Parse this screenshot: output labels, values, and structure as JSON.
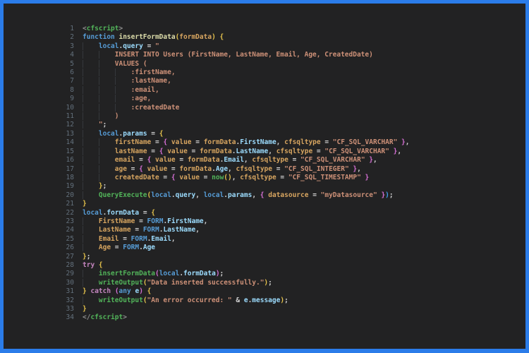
{
  "meta": {
    "frame_border_color": "#2b7ce9",
    "editor_background": "#222223",
    "line_number_color": "#63707c",
    "indent_guide_color": "#35383c"
  },
  "colors": {
    "g": "#52b45a",
    "b": "#569cd6",
    "lb": "#9cdcfe",
    "id": "#d7a560",
    "fn": "#dcdcaa",
    "s": "#ce9178",
    "k": "#c586c0",
    "p": "#d4d4d4",
    "ab": "#8d8d8d",
    "y": "#e6c34c",
    "m": "#d670d6",
    "bb": "#3d9fef"
  },
  "code": {
    "language": "cfscript",
    "lines": [
      {
        "n": 1,
        "i": 0,
        "t": [
          [
            "ab",
            "<"
          ],
          [
            "g",
            "cfscript"
          ],
          [
            "ab",
            ">"
          ]
        ]
      },
      {
        "n": 2,
        "i": 0,
        "t": [
          [
            "b",
            "function "
          ],
          [
            "fn",
            "insertFormData"
          ],
          [
            "y",
            "("
          ],
          [
            "id",
            "formData"
          ],
          [
            "y",
            ")"
          ],
          [
            "p",
            " "
          ],
          [
            "y",
            "{"
          ]
        ]
      },
      {
        "n": 3,
        "i": 1,
        "t": [
          [
            "b",
            "local"
          ],
          [
            "p",
            "."
          ],
          [
            "lb",
            "query"
          ],
          [
            "p",
            " = "
          ],
          [
            "s",
            "\""
          ]
        ]
      },
      {
        "n": 4,
        "i": 2,
        "t": [
          [
            "s",
            "INSERT INTO Users (FirstName, LastName, Email, Age, CreatedDate)"
          ]
        ]
      },
      {
        "n": 5,
        "i": 2,
        "t": [
          [
            "s",
            "VALUES ("
          ]
        ]
      },
      {
        "n": 6,
        "i": 3,
        "t": [
          [
            "s",
            ":firstName,"
          ]
        ]
      },
      {
        "n": 7,
        "i": 3,
        "t": [
          [
            "s",
            ":lastName,"
          ]
        ]
      },
      {
        "n": 8,
        "i": 3,
        "t": [
          [
            "s",
            ":email,"
          ]
        ]
      },
      {
        "n": 9,
        "i": 3,
        "t": [
          [
            "s",
            ":age,"
          ]
        ]
      },
      {
        "n": 10,
        "i": 3,
        "t": [
          [
            "s",
            ":createdDate"
          ]
        ]
      },
      {
        "n": 11,
        "i": 2,
        "t": [
          [
            "s",
            ")"
          ]
        ]
      },
      {
        "n": 12,
        "i": 1,
        "t": [
          [
            "s",
            "\""
          ],
          [
            "p",
            ";"
          ]
        ]
      },
      {
        "n": 13,
        "i": 1,
        "t": [
          [
            "b",
            "local"
          ],
          [
            "p",
            "."
          ],
          [
            "lb",
            "params"
          ],
          [
            "p",
            " = "
          ],
          [
            "y",
            "{"
          ]
        ]
      },
      {
        "n": 14,
        "i": 2,
        "t": [
          [
            "id",
            "firstName"
          ],
          [
            "p",
            " = "
          ],
          [
            "m",
            "{"
          ],
          [
            "p",
            " "
          ],
          [
            "id",
            "value"
          ],
          [
            "p",
            " = "
          ],
          [
            "id",
            "formData"
          ],
          [
            "p",
            "."
          ],
          [
            "lb",
            "FirstName"
          ],
          [
            "p",
            ", "
          ],
          [
            "id",
            "cfsqltype"
          ],
          [
            "p",
            " = "
          ],
          [
            "s",
            "\"CF_SQL_VARCHAR\""
          ],
          [
            "m",
            " }"
          ],
          [
            "p",
            ","
          ]
        ]
      },
      {
        "n": 15,
        "i": 2,
        "t": [
          [
            "id",
            "lastName"
          ],
          [
            "p",
            " = "
          ],
          [
            "m",
            "{"
          ],
          [
            "p",
            " "
          ],
          [
            "id",
            "value"
          ],
          [
            "p",
            " = "
          ],
          [
            "id",
            "formData"
          ],
          [
            "p",
            "."
          ],
          [
            "lb",
            "LastName"
          ],
          [
            "p",
            ", "
          ],
          [
            "id",
            "cfsqltype"
          ],
          [
            "p",
            " = "
          ],
          [
            "s",
            "\"CF_SQL_VARCHAR\""
          ],
          [
            "m",
            " }"
          ],
          [
            "p",
            ","
          ]
        ]
      },
      {
        "n": 16,
        "i": 2,
        "t": [
          [
            "id",
            "email"
          ],
          [
            "p",
            " = "
          ],
          [
            "m",
            "{"
          ],
          [
            "p",
            " "
          ],
          [
            "id",
            "value"
          ],
          [
            "p",
            " = "
          ],
          [
            "id",
            "formData"
          ],
          [
            "p",
            "."
          ],
          [
            "lb",
            "Email"
          ],
          [
            "p",
            ", "
          ],
          [
            "id",
            "cfsqltype"
          ],
          [
            "p",
            " = "
          ],
          [
            "s",
            "\"CF_SQL_VARCHAR\""
          ],
          [
            "m",
            " }"
          ],
          [
            "p",
            ","
          ]
        ]
      },
      {
        "n": 17,
        "i": 2,
        "t": [
          [
            "id",
            "age"
          ],
          [
            "p",
            " = "
          ],
          [
            "m",
            "{"
          ],
          [
            "p",
            " "
          ],
          [
            "id",
            "value"
          ],
          [
            "p",
            " = "
          ],
          [
            "id",
            "formData"
          ],
          [
            "p",
            "."
          ],
          [
            "lb",
            "Age"
          ],
          [
            "p",
            ", "
          ],
          [
            "id",
            "cfsqltype"
          ],
          [
            "p",
            " = "
          ],
          [
            "s",
            "\"CF_SQL_INTEGER\""
          ],
          [
            "m",
            " }"
          ],
          [
            "p",
            ","
          ]
        ]
      },
      {
        "n": 18,
        "i": 2,
        "t": [
          [
            "id",
            "createdDate"
          ],
          [
            "p",
            " = "
          ],
          [
            "m",
            "{"
          ],
          [
            "p",
            " "
          ],
          [
            "id",
            "value"
          ],
          [
            "p",
            " = "
          ],
          [
            "g",
            "now"
          ],
          [
            "y",
            "()"
          ],
          [
            "p",
            ", "
          ],
          [
            "id",
            "cfsqltype"
          ],
          [
            "p",
            " = "
          ],
          [
            "s",
            "\"CF_SQL_TIMESTAMP\""
          ],
          [
            "m",
            " }"
          ]
        ]
      },
      {
        "n": 19,
        "i": 1,
        "t": [
          [
            "y",
            "}"
          ],
          [
            "p",
            ";"
          ]
        ]
      },
      {
        "n": 20,
        "i": 1,
        "t": [
          [
            "g",
            "QueryExecute"
          ],
          [
            "y",
            "("
          ],
          [
            "b",
            "local"
          ],
          [
            "p",
            "."
          ],
          [
            "lb",
            "query"
          ],
          [
            "p",
            ", "
          ],
          [
            "b",
            "local"
          ],
          [
            "p",
            "."
          ],
          [
            "lb",
            "params"
          ],
          [
            "p",
            ", "
          ],
          [
            "m",
            "{"
          ],
          [
            "p",
            " "
          ],
          [
            "id",
            "datasource"
          ],
          [
            "p",
            " = "
          ],
          [
            "s",
            "\"myDatasource\""
          ],
          [
            "m",
            " }"
          ],
          [
            "bb",
            ")"
          ],
          [
            "p",
            ";"
          ]
        ]
      },
      {
        "n": 21,
        "i": 0,
        "t": [
          [
            "y",
            "}"
          ]
        ]
      },
      {
        "n": 22,
        "i": 0,
        "t": [
          [
            "b",
            "local"
          ],
          [
            "p",
            "."
          ],
          [
            "lb",
            "formData"
          ],
          [
            "p",
            " = "
          ],
          [
            "y",
            "{"
          ]
        ]
      },
      {
        "n": 23,
        "i": 1,
        "t": [
          [
            "id",
            "FirstName"
          ],
          [
            "p",
            " = "
          ],
          [
            "b",
            "FORM"
          ],
          [
            "p",
            "."
          ],
          [
            "lb",
            "FirstName"
          ],
          [
            "p",
            ","
          ]
        ]
      },
      {
        "n": 24,
        "i": 1,
        "t": [
          [
            "id",
            "LastName"
          ],
          [
            "p",
            " = "
          ],
          [
            "b",
            "FORM"
          ],
          [
            "p",
            "."
          ],
          [
            "lb",
            "LastName"
          ],
          [
            "p",
            ","
          ]
        ]
      },
      {
        "n": 25,
        "i": 1,
        "t": [
          [
            "id",
            "Email"
          ],
          [
            "p",
            " = "
          ],
          [
            "b",
            "FORM"
          ],
          [
            "p",
            "."
          ],
          [
            "lb",
            "Email"
          ],
          [
            "p",
            ","
          ]
        ]
      },
      {
        "n": 26,
        "i": 1,
        "t": [
          [
            "id",
            "Age"
          ],
          [
            "p",
            " = "
          ],
          [
            "b",
            "FORM"
          ],
          [
            "p",
            "."
          ],
          [
            "lb",
            "Age"
          ]
        ]
      },
      {
        "n": 27,
        "i": 0,
        "t": [
          [
            "y",
            "}"
          ],
          [
            "p",
            ";"
          ]
        ]
      },
      {
        "n": 28,
        "i": 0,
        "t": [
          [
            "k",
            "try"
          ],
          [
            "p",
            " "
          ],
          [
            "y",
            "{"
          ]
        ]
      },
      {
        "n": 29,
        "i": 1,
        "t": [
          [
            "g",
            "insertFormData"
          ],
          [
            "m",
            "("
          ],
          [
            "b",
            "local"
          ],
          [
            "p",
            "."
          ],
          [
            "lb",
            "formData"
          ],
          [
            "m",
            ")"
          ],
          [
            "p",
            ";"
          ]
        ]
      },
      {
        "n": 30,
        "i": 1,
        "t": [
          [
            "g",
            "writeOutput"
          ],
          [
            "y",
            "("
          ],
          [
            "s",
            "\"Data inserted successfully.\""
          ],
          [
            "y",
            ")"
          ],
          [
            "p",
            ";"
          ]
        ]
      },
      {
        "n": 31,
        "i": 0,
        "t": [
          [
            "y",
            "}"
          ],
          [
            "p",
            " "
          ],
          [
            "k",
            "catch"
          ],
          [
            "p",
            " "
          ],
          [
            "m",
            "("
          ],
          [
            "b",
            "any"
          ],
          [
            "p",
            " "
          ],
          [
            "lb",
            "e"
          ],
          [
            "m",
            ")"
          ],
          [
            "p",
            " "
          ],
          [
            "y",
            "{"
          ]
        ]
      },
      {
        "n": 32,
        "i": 1,
        "t": [
          [
            "g",
            "writeOutput"
          ],
          [
            "y",
            "("
          ],
          [
            "s",
            "\"An error occurred: \""
          ],
          [
            "p",
            " & "
          ],
          [
            "lb",
            "e"
          ],
          [
            "p",
            "."
          ],
          [
            "lb",
            "message"
          ],
          [
            "y",
            ")"
          ],
          [
            "p",
            ";"
          ]
        ]
      },
      {
        "n": 33,
        "i": 0,
        "t": [
          [
            "y",
            "}"
          ]
        ]
      },
      {
        "n": 34,
        "i": 0,
        "t": [
          [
            "ab",
            "</"
          ],
          [
            "g",
            "cfscript"
          ],
          [
            "ab",
            ">"
          ]
        ]
      }
    ]
  }
}
